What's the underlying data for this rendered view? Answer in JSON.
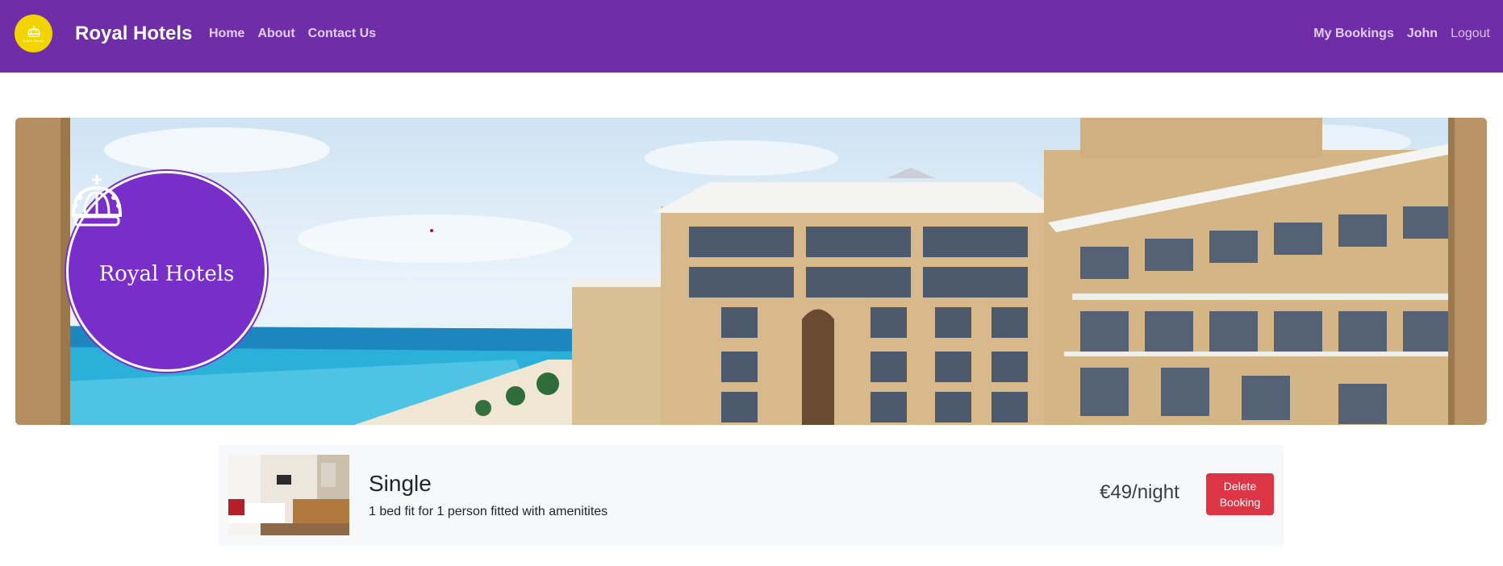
{
  "brand": {
    "name": "Royal Hotels",
    "logo_icon": "crown-icon",
    "logo_text": "Royal Hotels",
    "logo_bg": "#f2d500"
  },
  "nav": {
    "left": [
      {
        "label": "Home"
      },
      {
        "label": "About"
      },
      {
        "label": "Contact Us"
      }
    ],
    "right": {
      "bookings": "My Bookings",
      "user": "John",
      "logout": "Logout"
    },
    "bg_color": "#6f2da8"
  },
  "hero": {
    "badge_text": "Royal Hotels",
    "badge_icon": "crown-icon",
    "badge_color": "#7a2ec9"
  },
  "booking": {
    "room_name": "Single",
    "description": "1 bed fit for 1 person fitted with amenitites",
    "price": "€49/night",
    "delete_label": "Delete\nBooking",
    "delete_color": "#dc3545",
    "thumbnail_icon": "hotel-room-image"
  }
}
